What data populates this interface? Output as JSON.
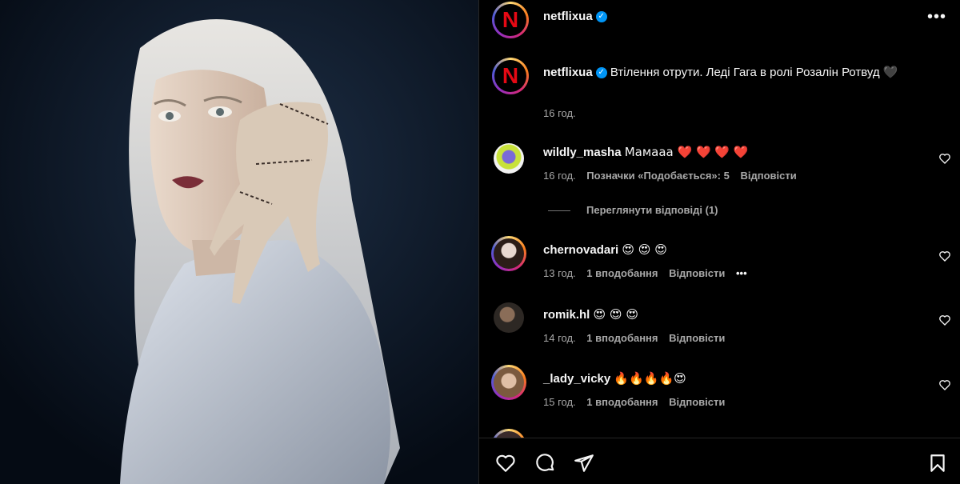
{
  "post": {
    "author": "netflixua",
    "verified_mark": "✓",
    "caption": "Втілення отрути. Леді Гага в ролі Розалін Ротвуд 🖤",
    "caption_time": "16 год.",
    "more": "•••"
  },
  "comments": [
    {
      "user": "wildly_masha",
      "text": "Мамааа ❤️ ❤️ ❤️ ❤️",
      "time": "16 год.",
      "likes": "Позначки «Подобається»: 5",
      "reply": "Відповісти",
      "view_replies": "Переглянути відповіді (1)"
    },
    {
      "user": "chernovadari",
      "text": "😍 😍 😍",
      "time": "13 год.",
      "likes": "1 вподобання",
      "reply": "Відповісти",
      "more": "•••"
    },
    {
      "user": "romik.hl",
      "text": "😍 😍 😍",
      "time": "14 год.",
      "likes": "1 вподобання",
      "reply": "Відповісти"
    },
    {
      "user": "_lady_vicky",
      "text": "🔥🔥🔥🔥😍",
      "time": "15 год.",
      "likes": "1 вподобання",
      "reply": "Відповісти"
    }
  ],
  "icons": {
    "like": "heart-icon",
    "comment": "comment-icon",
    "share": "share-icon",
    "save": "bookmark-icon",
    "options": "more-options-icon"
  },
  "colors": {
    "background": "#000000",
    "text": "#f5f5f5",
    "secondary": "#a8a8a8",
    "verified": "#0095f6",
    "brand": "#e50914"
  }
}
